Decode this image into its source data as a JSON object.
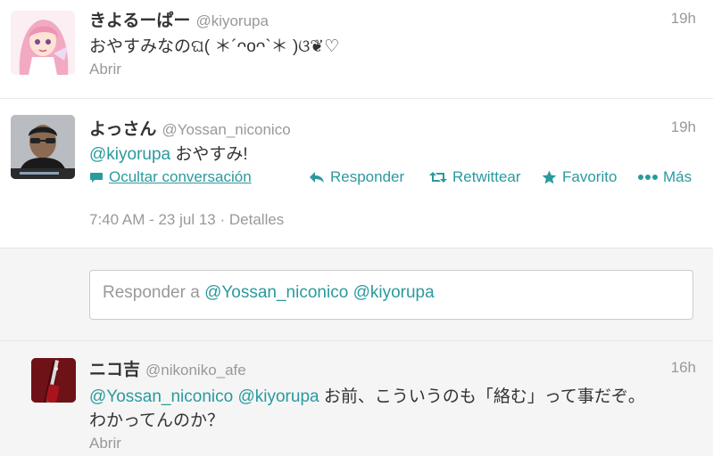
{
  "colors": {
    "link": "#2a9a9e",
    "muted": "#999999",
    "text": "#333333",
    "background_alt": "#f5f5f5"
  },
  "tweets": [
    {
      "fullname": "きよるーぱー",
      "username": "@kiyorupa",
      "time": "19h",
      "text": "おやすみなのଘ( ＊´ᴖoᴖ`＊ )ଓ❦♡",
      "expand": "Abrir",
      "avatar_icon": "anime-girl-avatar"
    },
    {
      "fullname": "よっさん",
      "username": "@Yossan_niconico",
      "time": "19h",
      "mention": "@kiyorupa",
      "text": " おやすみ!",
      "avatar_icon": "person-photo-avatar",
      "actions": {
        "conversation": "Ocultar conversación",
        "reply": "Responder",
        "retweet": "Retwittear",
        "favorite": "Favorito",
        "more": "Más"
      },
      "timestamp": "7:40 AM - 23 jul 13",
      "details": "Detalles"
    },
    {
      "fullname": "ニコ吉",
      "username": "@nikoniko_afe",
      "time": "16h",
      "mention1": "@Yossan_niconico",
      "mention2": "@kiyorupa",
      "text_line1": " お前、こういうのも「絡む」って事だぞ。",
      "text_line2": "わかってんのか？",
      "expand": "Abrir",
      "avatar_icon": "guitar-avatar"
    }
  ],
  "reply_box": {
    "prefix": "Responder a",
    "mention1": "@Yossan_niconico",
    "mention2": "@kiyorupa"
  }
}
